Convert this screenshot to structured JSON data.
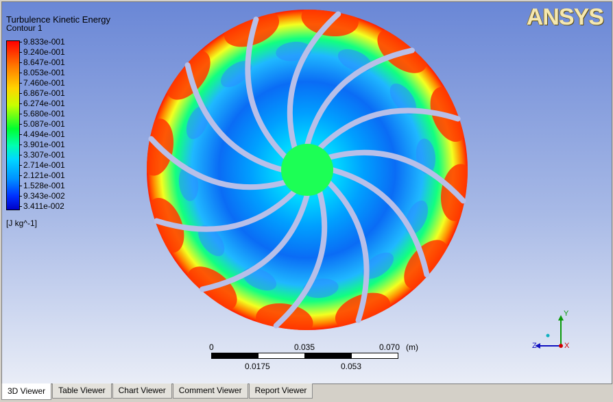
{
  "legend": {
    "title": "Turbulence Kinetic Energy",
    "subtitle": "Contour 1",
    "ticks": [
      "9.833e-001",
      "9.240e-001",
      "8.647e-001",
      "8.053e-001",
      "7.460e-001",
      "6.867e-001",
      "6.274e-001",
      "5.680e-001",
      "5.087e-001",
      "4.494e-001",
      "3.901e-001",
      "3.307e-001",
      "2.714e-001",
      "2.121e-001",
      "1.528e-001",
      "9.343e-002",
      "3.411e-002"
    ],
    "units": "[J kg^-1]"
  },
  "logo": "ANSYS",
  "scale": {
    "top_labels": [
      "0",
      "0.035",
      "0.070"
    ],
    "unit": "(m)",
    "bottom_labels": [
      "0.0175",
      "0.053"
    ]
  },
  "axes": {
    "y": "Y",
    "z": "Z",
    "x": "X"
  },
  "tabs": [
    "3D Viewer",
    "Table Viewer",
    "Chart Viewer",
    "Comment Viewer",
    "Report Viewer"
  ],
  "active_tab": "3D Viewer",
  "colors": {
    "max": "#ff0000",
    "mid": "#00ff30",
    "min": "#0000c8",
    "blade": "#b8bfe8"
  }
}
